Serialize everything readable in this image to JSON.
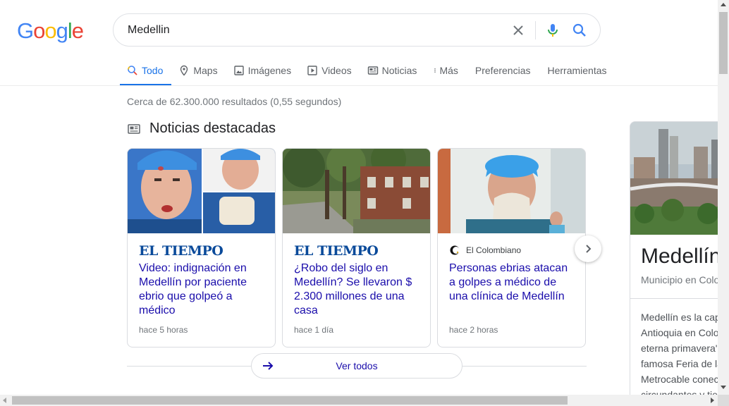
{
  "search": {
    "query": "Medellin",
    "logo_letters": [
      "G",
      "o",
      "o",
      "g",
      "l",
      "e"
    ],
    "logo_colors": [
      "#4285f4",
      "#ea4335",
      "#fbbc05",
      "#4285f4",
      "#34a853",
      "#ea4335"
    ]
  },
  "tabs": [
    {
      "label": "Todo",
      "icon": "search-icon",
      "active": true
    },
    {
      "label": "Maps",
      "icon": "map-pin-icon"
    },
    {
      "label": "Imágenes",
      "icon": "image-icon"
    },
    {
      "label": "Videos",
      "icon": "play-icon"
    },
    {
      "label": "Noticias",
      "icon": "newspaper-icon"
    },
    {
      "label": "Más",
      "icon": "more-vert-icon"
    },
    {
      "label": "Preferencias"
    },
    {
      "label": "Herramientas"
    }
  ],
  "result_stats": "Cerca de 62.300.000 resultados (0,55 segundos)",
  "top_stories": {
    "title": "Noticias destacadas",
    "cards": [
      {
        "source": "EL TIEMPO",
        "headline": "Video: indignación en Medellín por paciente ebrio que golpeó a médico",
        "time": "hace 5 horas"
      },
      {
        "source": "EL TIEMPO",
        "headline": "¿Robo del siglo en Medellín? Se llevaron $ 2.300 millones de una casa",
        "time": "hace 1 día"
      },
      {
        "source": "El Colombiano",
        "headline": "Personas ebrias atacan a golpes a médico de una clínica de Medellín",
        "time": "hace 2 horas"
      }
    ],
    "see_all": "Ver todos"
  },
  "knowledge_panel": {
    "title": "Medellín",
    "subtitle": "Municipio en Colombia",
    "description_lines": [
      "Medellín es la capital de",
      "Antioquia en Colombia,",
      "eterna primavera\", es",
      "famosa Feria de las Flores",
      "Metrocable conecta",
      "circundantes y tiene"
    ]
  },
  "colors": {
    "accent": "#1a73e8",
    "link": "#1a0dab",
    "tiempo_blue": "#0a4a9a"
  }
}
